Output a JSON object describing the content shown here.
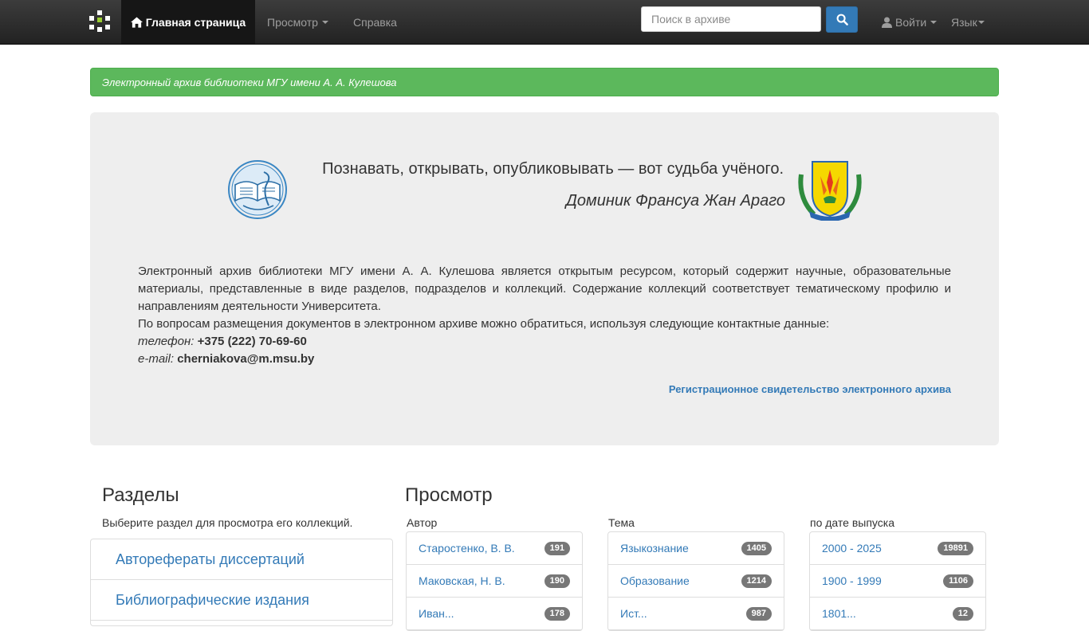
{
  "navbar": {
    "home_label": "Главная страница",
    "browse_label": "Просмотр",
    "help_label": "Справка",
    "search_placeholder": "Поиск в архиве",
    "login_label": "Войти",
    "language_label": "Язык"
  },
  "banner": {
    "text": "Электронный архив библиотеки МГУ имени А. А. Кулешова"
  },
  "jumbotron": {
    "quote": "Познавать, открывать, опубликовывать — вот судьба учёного.",
    "quote_author": "Доминик Франсуа Жан Араго",
    "description": "Электронный архив библиотеки МГУ имени А. А. Кулешова является открытым ресурсом, который содержит научные, образовательные материалы, представленные в виде разделов, подразделов и коллекций. Содержание коллекций соответствует тематическому профилю и направлениям деятельности Университета.",
    "contact_intro": "По вопросам размещения документов в электронном архиве можно обратиться, используя следующие контактные данные:",
    "phone_label": "телефон:",
    "phone_value": "+375 (222) 70-69-60",
    "email_label": "e-mail:",
    "email_value": "cherniakova@m.msu.by",
    "registration_link": "Регистрационное свидетельство электронного архива"
  },
  "sections": {
    "title": "Разделы",
    "subtitle": "Выберите раздел для просмотра его коллекций.",
    "items": [
      {
        "label": "Автореферaты диссертаций"
      },
      {
        "label": "Библиографические издания"
      }
    ]
  },
  "browse": {
    "title": "Просмотр",
    "columns": [
      {
        "caption": "Автор",
        "items": [
          {
            "label": "Старостенко, В. В.",
            "count": "191"
          },
          {
            "label": "Маковская, Н. В.",
            "count": "190"
          },
          {
            "label": "Иван...",
            "count": "178"
          }
        ]
      },
      {
        "caption": "Тема",
        "items": [
          {
            "label": "Языкознание",
            "count": "1405"
          },
          {
            "label": "Образование",
            "count": "1214"
          },
          {
            "label": "Ист...",
            "count": "987"
          }
        ]
      },
      {
        "caption": "по дате выпуска",
        "items": [
          {
            "label": "2000 - 2025",
            "count": "19891"
          },
          {
            "label": "1900 - 1999",
            "count": "1106"
          },
          {
            "label": "1801...",
            "count": "12"
          }
        ]
      }
    ]
  },
  "colors": {
    "navbar": "#222222",
    "banner_green": "#5cb85c",
    "link_blue": "#337ab7",
    "jumbotron_bg": "#eeeeee",
    "badge_gray": "#777777"
  }
}
